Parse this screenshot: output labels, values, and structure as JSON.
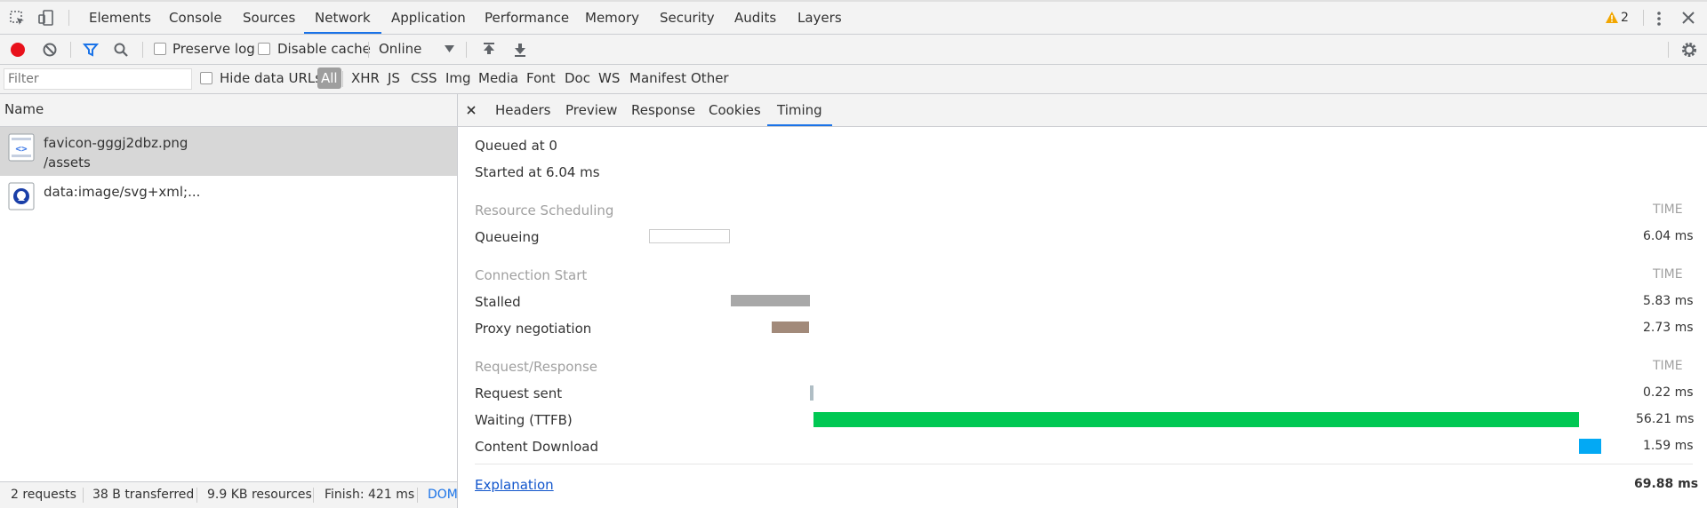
{
  "tabs": {
    "items": [
      "Elements",
      "Console",
      "Sources",
      "Network",
      "Application",
      "Performance",
      "Memory",
      "Security",
      "Audits",
      "Layers"
    ],
    "active": "Network",
    "warning_count": "2"
  },
  "toolbar": {
    "preserve_log": "Preserve log",
    "disable_cache": "Disable cache",
    "throttle": "Online"
  },
  "filter": {
    "placeholder": "Filter",
    "hide_data_urls": "Hide data URLs",
    "types": [
      "All",
      "XHR",
      "JS",
      "CSS",
      "Img",
      "Media",
      "Font",
      "Doc",
      "WS",
      "Manifest",
      "Other"
    ]
  },
  "requests": {
    "header": "Name",
    "items": [
      {
        "name": "favicon-gggj2dbz.png",
        "path": "/assets",
        "icon": "image-file-icon"
      },
      {
        "name": "data:image/svg+xml;...",
        "path": "",
        "icon": "svg-file-icon"
      }
    ]
  },
  "status": {
    "requests": "2 requests",
    "transferred": "38 B transferred",
    "resources": "9.9 KB resources",
    "finish": "Finish: 421 ms",
    "dom": "DOM"
  },
  "detail_tabs": {
    "items": [
      "Headers",
      "Preview",
      "Response",
      "Cookies",
      "Timing"
    ],
    "active": "Timing"
  },
  "timing": {
    "queued_at": "Queued at 0",
    "started_at": "Started at 6.04 ms",
    "time_label": "TIME",
    "sections": [
      {
        "title": "Resource Scheduling",
        "rows": [
          {
            "label": "Queueing",
            "value": "6.04 ms",
            "color": "#ffffff"
          }
        ]
      },
      {
        "title": "Connection Start",
        "rows": [
          {
            "label": "Stalled",
            "value": "5.83 ms",
            "color": "#a8a8a8"
          },
          {
            "label": "Proxy negotiation",
            "value": "2.73 ms",
            "color": "#a28a7a"
          }
        ]
      },
      {
        "title": "Request/Response",
        "rows": [
          {
            "label": "Request sent",
            "value": "0.22 ms",
            "color": "#b0bec5"
          },
          {
            "label": "Waiting (TTFB)",
            "value": "56.21 ms",
            "color": "#00c853"
          },
          {
            "label": "Content Download",
            "value": "1.59 ms",
            "color": "#03a9f4"
          }
        ]
      }
    ],
    "explanation": "Explanation",
    "total": "69.88 ms"
  },
  "colors": {
    "accent": "#1a73e8",
    "record": "#e8111b",
    "warning": "#f2a600"
  }
}
